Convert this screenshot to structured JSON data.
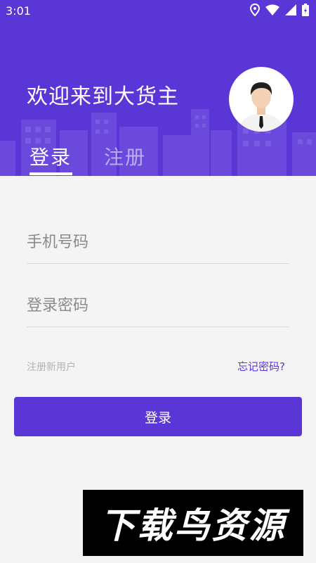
{
  "status_bar": {
    "time": "3:01"
  },
  "header": {
    "welcome": "欢迎来到大货主"
  },
  "tabs": [
    {
      "label": "登录",
      "active": true
    },
    {
      "label": "注册",
      "active": false
    }
  ],
  "form": {
    "phone_placeholder": "手机号码",
    "password_placeholder": "登录密码",
    "register_link": "注册新用户",
    "forgot_link": "忘记密码?",
    "login_button": "登录"
  },
  "watermark": {
    "text": "下载鸟资源"
  },
  "colors": {
    "accent": "#5b36d6",
    "background": "#f4f4f4"
  },
  "icons": [
    "location-icon",
    "wifi-icon",
    "signal-icon",
    "battery-icon",
    "avatar-icon"
  ]
}
